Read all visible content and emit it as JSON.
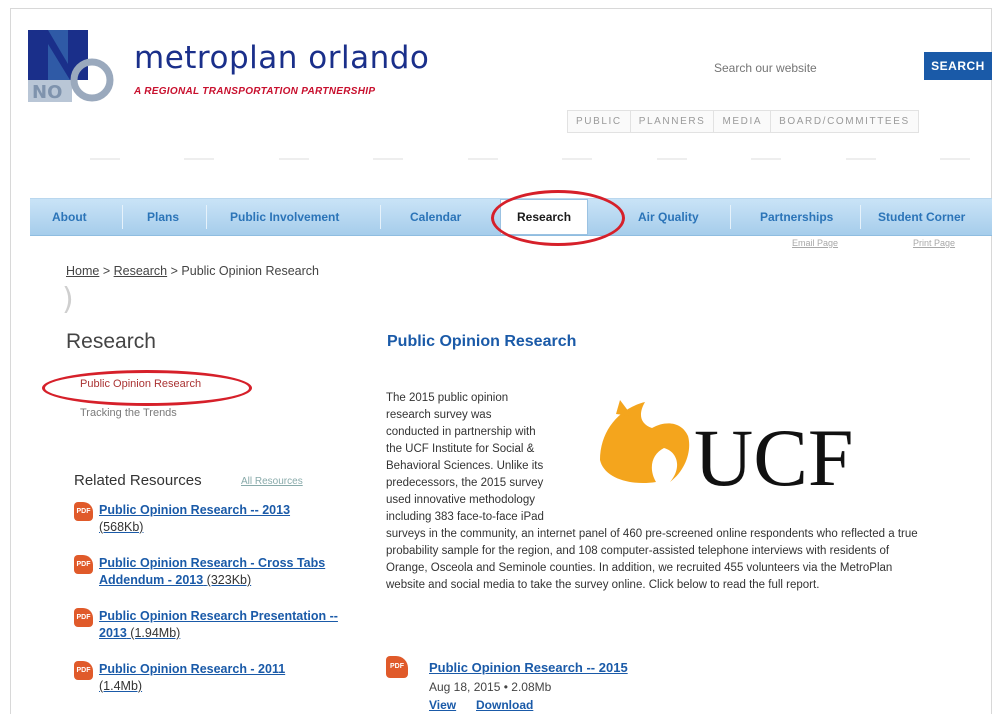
{
  "brand": {
    "name": "metroplan orlando",
    "tagline": "A REGIONAL TRANSPORTATION PARTNERSHIP",
    "colors": {
      "navy": "#1a2f8a",
      "red": "#c8102e",
      "link": "#1a5aa8"
    }
  },
  "search": {
    "placeholder": "Search our website",
    "button": "SEARCH"
  },
  "audience_tabs": [
    "PUBLIC",
    "PLANNERS",
    "MEDIA",
    "BOARD/COMMITTEES"
  ],
  "nav": {
    "items": [
      "About",
      "Plans",
      "Public Involvement",
      "Calendar",
      "Research",
      "Air Quality",
      "Partnerships",
      "Student Corner"
    ],
    "active": "Research"
  },
  "utility": {
    "email": "Email Page",
    "print": "Print Page"
  },
  "breadcrumb": {
    "home": "Home",
    "sep": ">",
    "section": "Research",
    "current": "Public Opinion Research"
  },
  "sidebar": {
    "title": "Research",
    "links": [
      "Public Opinion Research",
      "Tracking the Trends"
    ],
    "related_heading": "Related Resources",
    "all_resources": "All Resources",
    "resources": [
      {
        "title": "Public Opinion Research -- 2013",
        "size": "(568Kb)"
      },
      {
        "title": "Public Opinion Research - Cross Tabs Addendum - 2013",
        "size": "(323Kb)"
      },
      {
        "title": "Public Opinion Research Presentation -- 2013",
        "size": "(1.94Mb)"
      },
      {
        "title": "Public Opinion Research - 2011",
        "size": "(1.4Mb)"
      }
    ],
    "pdf_badge": "PDF"
  },
  "article": {
    "title": "Public Opinion Research",
    "body": "The 2015 public opinion research survey was conducted in partnership with the UCF Institute for Social & Behavioral Sciences. Unlike its predecessors, the 2015 survey used innovative methodology including 383 face-to-face iPad surveys in the community, an internet panel of 460 pre-screened online respondents who reflected a true probability sample for the region, and 108 computer-assisted telephone interviews with residents of Orange, Osceola and Seminole counties. In addition, we recruited 455 volunteers via the MetroPlan website and social media to take the survey online. Click below to read the full report.",
    "logo_text": "UCF",
    "download": {
      "title": "Public Opinion Research -- 2015",
      "meta": "Aug 18, 2015 • 2.08Mb",
      "view": "View",
      "download": "Download"
    }
  }
}
